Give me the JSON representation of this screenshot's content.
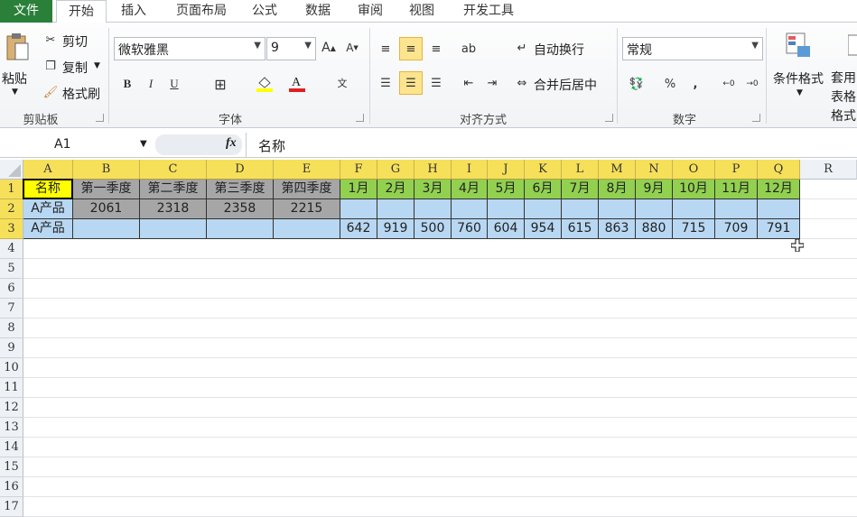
{
  "tabs": [
    "文件",
    "开始",
    "插入",
    "页面布局",
    "公式",
    "数据",
    "审阅",
    "视图",
    "开发工具"
  ],
  "clipboard": {
    "paste": "粘贴",
    "cut": "剪切",
    "copy": "复制",
    "painter": "格式刷",
    "group": "剪贴板"
  },
  "font": {
    "name": "微软雅黑",
    "size": "9",
    "bold": "B",
    "italic": "I",
    "underline": "U",
    "group": "字体"
  },
  "alignment": {
    "wrap": "自动换行",
    "merge": "合并后居中",
    "group": "对齐方式"
  },
  "number": {
    "format": "常规",
    "percent": "%",
    "comma": ",",
    "group": "数字"
  },
  "styles": {
    "conditional": "条件格式",
    "table": "套用表格格式"
  },
  "formula_bar": {
    "name_box": "A1",
    "fx": "fx",
    "content": "名称"
  },
  "columns": [
    "A",
    "B",
    "C",
    "D",
    "E",
    "F",
    "G",
    "H",
    "I",
    "J",
    "K",
    "L",
    "M",
    "N",
    "O",
    "P",
    "Q",
    "R"
  ],
  "rows": [
    "1",
    "2",
    "3",
    "4",
    "5",
    "6",
    "7",
    "8",
    "9",
    "10",
    "11",
    "12",
    "13",
    "14",
    "15",
    "16",
    "17"
  ],
  "sheet": [
    [
      "名称",
      "第一季度",
      "第二季度",
      "第三季度",
      "第四季度",
      "1月",
      "2月",
      "3月",
      "4月",
      "5月",
      "6月",
      "7月",
      "8月",
      "9月",
      "10月",
      "11月",
      "12月"
    ],
    [
      "A产品",
      "2061",
      "2318",
      "2358",
      "2215",
      "",
      "",
      "",
      "",
      "",
      "",
      "",
      "",
      "",
      "",
      "",
      ""
    ],
    [
      "A产品",
      "",
      "",
      "",
      "",
      "642",
      "919",
      "500",
      "760",
      "604",
      "954",
      "615",
      "863",
      "880",
      "715",
      "709",
      "791"
    ]
  ],
  "colors": {
    "header_yellow": "#ffff00",
    "quarter_gray": "#a6a6a6",
    "month_green": "#92d050",
    "light_blue": "#b8d7f2",
    "file_green": "#2a7f39"
  }
}
